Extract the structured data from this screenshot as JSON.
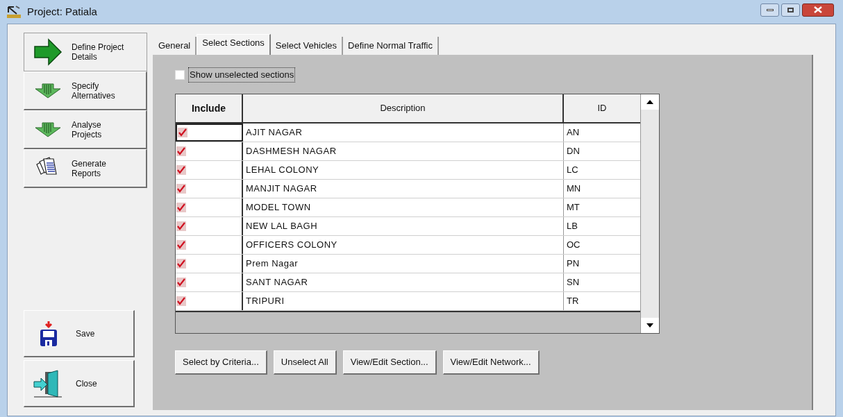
{
  "window": {
    "title": "Project: Patiala"
  },
  "sidebar": {
    "items": [
      {
        "label": "Define Project Details",
        "selected": true
      },
      {
        "label": "Specify Alternatives",
        "selected": false
      },
      {
        "label": "Analyse Projects",
        "selected": false
      },
      {
        "label": "Generate Reports",
        "selected": false
      }
    ],
    "actions": [
      "Save",
      "Close"
    ]
  },
  "tabs": [
    {
      "label": "General",
      "selected": false
    },
    {
      "label": "Select Sections",
      "selected": true
    },
    {
      "label": "Select Vehicles",
      "selected": false
    },
    {
      "label": "Define Normal Traffic",
      "selected": false
    }
  ],
  "show_unselected": {
    "label": "Show unselected sections",
    "checked": false
  },
  "table": {
    "columns": [
      "Include",
      "Description",
      "ID"
    ],
    "rows": [
      {
        "include": true,
        "description": "AJIT NAGAR",
        "id": "AN",
        "focused": true
      },
      {
        "include": true,
        "description": "DASHMESH NAGAR",
        "id": "DN",
        "focused": false
      },
      {
        "include": true,
        "description": "LEHAL COLONY",
        "id": "LC",
        "focused": false
      },
      {
        "include": true,
        "description": "MANJIT NAGAR",
        "id": "MN",
        "focused": false
      },
      {
        "include": true,
        "description": "MODEL TOWN",
        "id": "MT",
        "focused": false
      },
      {
        "include": true,
        "description": "NEW LAL BAGH",
        "id": "LB",
        "focused": false
      },
      {
        "include": true,
        "description": "OFFICERS COLONY",
        "id": "OC",
        "focused": false
      },
      {
        "include": true,
        "description": "Prem Nagar",
        "id": "PN",
        "focused": false
      },
      {
        "include": true,
        "description": "SANT NAGAR",
        "id": "SN",
        "focused": false
      },
      {
        "include": true,
        "description": "TRIPURI",
        "id": "TR",
        "focused": false
      }
    ]
  },
  "buttons": [
    "Select by Criteria...",
    "Unselect All",
    "View/Edit Section...",
    "View/Edit Network..."
  ]
}
